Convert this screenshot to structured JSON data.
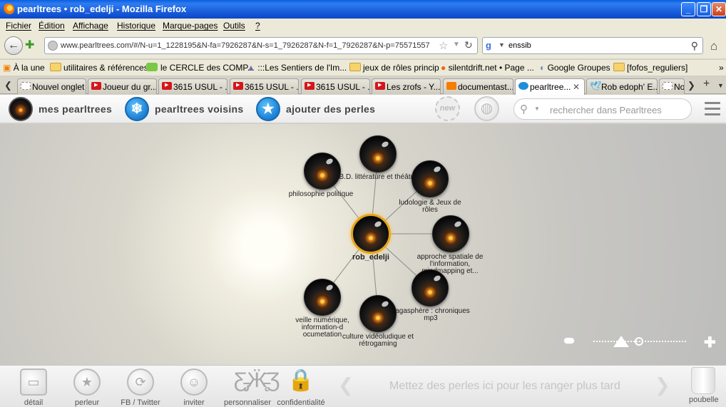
{
  "window": {
    "title": "pearltrees • rob_edelji - Mozilla Firefox",
    "controls": [
      "_",
      "❐",
      "✕"
    ]
  },
  "menu": [
    "Fichier",
    "Édition",
    "Affichage",
    "Historique",
    "Marque-pages",
    "Outils",
    "?"
  ],
  "nav": {
    "url": "www.pearltrees.com/#/N-u=1_1228195&N-fa=7926287&N-s=1_7926287&N-f=1_7926287&N-p=75571557",
    "search_value": "enssib"
  },
  "bookmarks": [
    "À la une",
    "utilitaires & références",
    "le CERCLE des COMP...",
    ":::Les Sentiers de l'Im...",
    "jeux de rôles princip",
    "silentdrift.net • Page ...",
    "Google Groupes",
    "[fofos_reguliers]"
  ],
  "tabs": [
    {
      "label": "Nouvel onglet",
      "icon": "blank"
    },
    {
      "label": "Joueur du gr...",
      "icon": "youtube"
    },
    {
      "label": "3615 USUL - ...",
      "icon": "youtube"
    },
    {
      "label": "3615 USUL - ...",
      "icon": "youtube"
    },
    {
      "label": "3615 USUL - ...",
      "icon": "youtube"
    },
    {
      "label": "Les zrofs - Y...",
      "icon": "youtube"
    },
    {
      "label": "documentast...",
      "icon": "blogger"
    },
    {
      "label": "pearltree...",
      "icon": "pearltrees",
      "active": true
    },
    {
      "label": "Rob edoph' E...",
      "icon": "twitter"
    },
    {
      "label": "No",
      "icon": "blank"
    }
  ],
  "header": {
    "my_pearltrees": "mes pearltrees",
    "neighbors": "pearltrees voisins",
    "add_pearls": "ajouter des perles",
    "new_badge": "new",
    "search_placeholder": "rechercher dans Pearltrees"
  },
  "tree": {
    "center": "rob_edelji",
    "children": [
      {
        "label": "philosophie politique"
      },
      {
        "label": "B.D. littérature et théâtre"
      },
      {
        "label": "ludologie & Jeux de rôles"
      },
      {
        "label": "approche spatiale de l'information, mindmapping et..."
      },
      {
        "label": "sagasphère : chroniques mp3"
      },
      {
        "label": "culture vidéoludique et rétrogaming"
      },
      {
        "label": "veille numérique, information-d ocumetation"
      }
    ]
  },
  "dock": {
    "buttons": [
      "détail",
      "perleur",
      "FB / Twitter",
      "inviter",
      "personnaliser",
      "confidentialité"
    ],
    "hint": "Mettez des perles ici pour les ranger plus tard",
    "trash": "poubelle"
  }
}
